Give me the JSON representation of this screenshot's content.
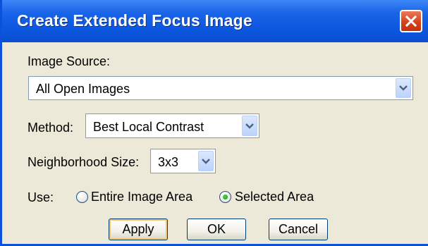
{
  "window": {
    "title": "Create Extended Focus Image",
    "close_icon": "close-icon"
  },
  "image_source": {
    "label": "Image Source:",
    "selected": "All Open Images"
  },
  "method": {
    "label": "Method:",
    "selected": "Best Local Contrast"
  },
  "neighborhood": {
    "label": "Neighborhood Size:",
    "selected": "3x3"
  },
  "use": {
    "label": "Use:",
    "option_entire": "Entire Image Area",
    "option_selected": "Selected Area",
    "checked": "Selected Area"
  },
  "buttons": {
    "apply": "Apply",
    "ok": "OK",
    "cancel": "Cancel"
  },
  "colors": {
    "titlebar": "#0a4fd2",
    "face": "#ece9d8",
    "close": "#d6431d"
  }
}
